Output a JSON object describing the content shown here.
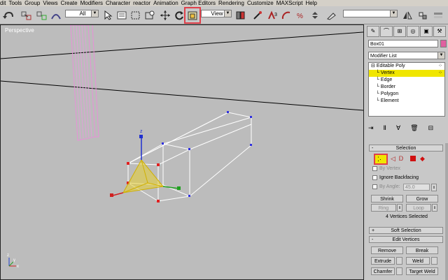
{
  "menu": [
    "dit",
    "Tools",
    "Group",
    "Views",
    "Create",
    "Modifiers",
    "Character",
    "reactor",
    "Animation",
    "Graph Editors",
    "Rendering",
    "Customize",
    "MAXScript",
    "Help"
  ],
  "toolbar": {
    "selection_filter": "All",
    "ref_coord": "View",
    "named_selection": ""
  },
  "viewport": {
    "label": "Perspective"
  },
  "command_panel": {
    "object_name": "Box01",
    "object_color": "#e060a0",
    "modifier_list": "Modifier List",
    "stack": [
      {
        "label": "Editable Poly",
        "level": 0,
        "selected": false
      },
      {
        "label": "Vertex",
        "level": 1,
        "selected": true
      },
      {
        "label": "Edge",
        "level": 1,
        "selected": false
      },
      {
        "label": "Border",
        "level": 1,
        "selected": false
      },
      {
        "label": "Polygon",
        "level": 1,
        "selected": false
      },
      {
        "label": "Element",
        "level": 1,
        "selected": false
      }
    ],
    "selection_rollout": {
      "title": "Selection",
      "by_vertex": "By Vertex",
      "ignore_backfacing": "Ignore Backfacing",
      "by_angle": "By Angle:",
      "angle_value": "45.0",
      "shrink": "Shrink",
      "grow": "Grow",
      "ring": "Ring",
      "loop": "Loop",
      "status": "4 Vertices Selected"
    },
    "soft_selection": "Soft Selection",
    "edit_vertices": {
      "title": "Edit Vertices",
      "remove": "Remove",
      "break": "Break",
      "extrude": "Extrude",
      "weld": "Weld",
      "chamfer": "Chamfer",
      "target_weld": "Target Weld"
    }
  }
}
